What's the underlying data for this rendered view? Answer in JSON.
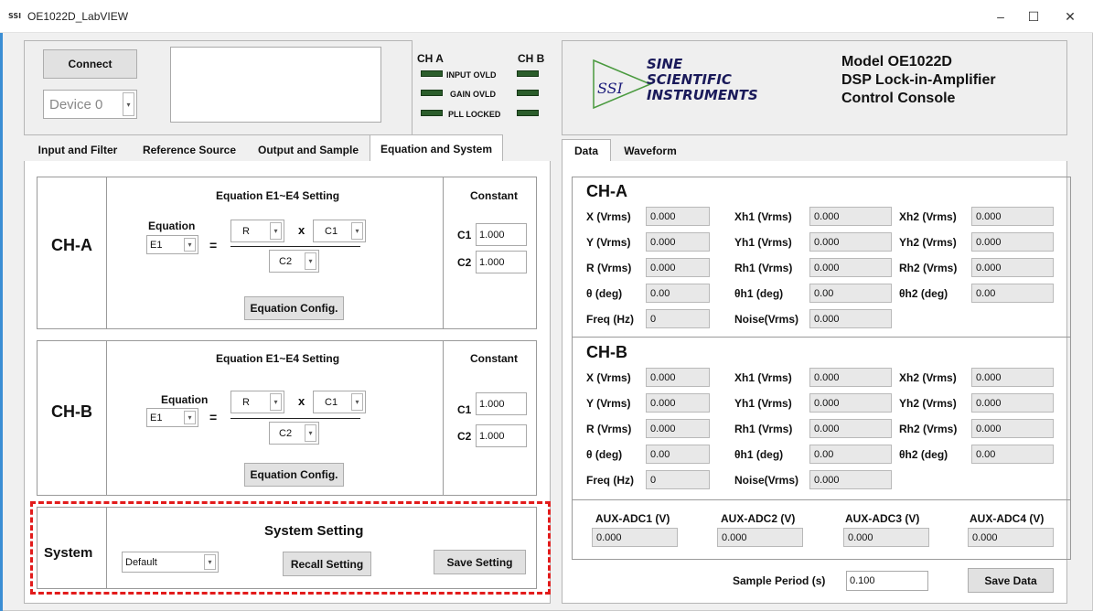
{
  "window": {
    "logo": "SSI",
    "title": "OE1022D_LabVIEW",
    "minimize": "–",
    "maximize": "☐",
    "close": "✕"
  },
  "connection": {
    "connect_label": "Connect",
    "device_value": "Device 0"
  },
  "indicators": {
    "cha_label": "CH A",
    "chb_label": "CH B",
    "input_ovld": "INPUT OVLD",
    "gain_ovld": "GAIN OVLD",
    "pll_locked": "PLL LOCKED",
    "led_color": "#2b5d2b"
  },
  "brand": {
    "logo": "SSI",
    "line1": "SINE",
    "line2": "SCIENTIFIC",
    "line3": "INSTRUMENTS",
    "model": "Model OE1022D",
    "subtitle1": "DSP Lock-in-Amplifier",
    "subtitle2": "Control Console",
    "accent": "#4a9a3f"
  },
  "left_tabs": [
    "Input and Filter",
    "Reference Source",
    "Output and Sample",
    "Equation and System"
  ],
  "right_tabs": [
    "Data",
    "Waveform"
  ],
  "equation_a": {
    "channel": "CH-A",
    "heading": "Equation E1~E4 Setting",
    "equation_label": "Equation",
    "equation_value": "E1",
    "equals": "=",
    "num1": "R",
    "times": "x",
    "num2": "C1",
    "denom": "C2",
    "config_label": "Equation Config.",
    "constant_heading": "Constant",
    "c1_label": "C1",
    "c1_value": "1.000",
    "c2_label": "C2",
    "c2_value": "1.000"
  },
  "equation_b": {
    "channel": "CH-B",
    "heading": "Equation E1~E4 Setting",
    "equation_label": "Equation",
    "equation_value": "E1",
    "equals": "=",
    "num1": "R",
    "times": "x",
    "num2": "C1",
    "denom": "C2",
    "config_label": "Equation Config.",
    "constant_heading": "Constant",
    "c1_label": "C1",
    "c1_value": "1.000",
    "c2_label": "C2",
    "c2_value": "1.000"
  },
  "system": {
    "label": "System",
    "heading": "System Setting",
    "preset_value": "Default",
    "recall_label": "Recall Setting",
    "save_label": "Save Setting",
    "highlight_color": "#e21b1b"
  },
  "data_a": {
    "title": "CH-A",
    "x_label": "X (Vrms)",
    "x_value": "0.000",
    "xh1_label": "Xh1 (Vrms)",
    "xh1_value": "0.000",
    "xh2_label": "Xh2 (Vrms)",
    "xh2_value": "0.000",
    "y_label": "Y (Vrms)",
    "y_value": "0.000",
    "yh1_label": "Yh1 (Vrms)",
    "yh1_value": "0.000",
    "yh2_label": "Yh2 (Vrms)",
    "yh2_value": "0.000",
    "r_label": "R (Vrms)",
    "r_value": "0.000",
    "rh1_label": "Rh1 (Vrms)",
    "rh1_value": "0.000",
    "rh2_label": "Rh2 (Vrms)",
    "rh2_value": "0.000",
    "t_label": "θ (deg)",
    "t_value": "0.00",
    "th1_label": "θh1 (deg)",
    "th1_value": "0.00",
    "th2_label": "θh2 (deg)",
    "th2_value": "0.00",
    "freq_label": "Freq (Hz)",
    "freq_value": "0",
    "noise_label": "Noise(Vrms)",
    "noise_value": "0.000"
  },
  "data_b": {
    "title": "CH-B",
    "x_label": "X (Vrms)",
    "x_value": "0.000",
    "xh1_label": "Xh1 (Vrms)",
    "xh1_value": "0.000",
    "xh2_label": "Xh2 (Vrms)",
    "xh2_value": "0.000",
    "y_label": "Y (Vrms)",
    "y_value": "0.000",
    "yh1_label": "Yh1 (Vrms)",
    "yh1_value": "0.000",
    "yh2_label": "Yh2 (Vrms)",
    "yh2_value": "0.000",
    "r_label": "R (Vrms)",
    "r_value": "0.000",
    "rh1_label": "Rh1 (Vrms)",
    "rh1_value": "0.000",
    "rh2_label": "Rh2 (Vrms)",
    "rh2_value": "0.000",
    "t_label": "θ (deg)",
    "t_value": "0.00",
    "th1_label": "θh1 (deg)",
    "th1_value": "0.00",
    "th2_label": "θh2 (deg)",
    "th2_value": "0.00",
    "freq_label": "Freq (Hz)",
    "freq_value": "0",
    "noise_label": "Noise(Vrms)",
    "noise_value": "0.000"
  },
  "aux": {
    "adc1_label": "AUX-ADC1 (V)",
    "adc1_value": "0.000",
    "adc2_label": "AUX-ADC2 (V)",
    "adc2_value": "0.000",
    "adc3_label": "AUX-ADC3 (V)",
    "adc3_value": "0.000",
    "adc4_label": "AUX-ADC4 (V)",
    "adc4_value": "0.000"
  },
  "sample": {
    "period_label": "Sample Period (s)",
    "period_value": "0.100",
    "save_data_label": "Save Data"
  }
}
